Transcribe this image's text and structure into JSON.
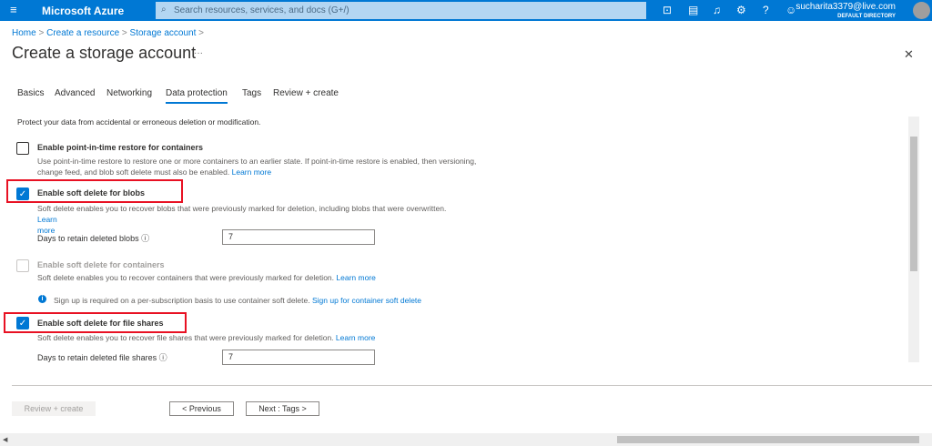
{
  "topbar": {
    "brand": "Microsoft Azure",
    "search_placeholder": "Search resources, services, and docs (G+/)",
    "user_email": "sucharita3379@live.com",
    "user_directory": "DEFAULT DIRECTORY"
  },
  "breadcrumb": [
    "Home",
    "Create a resource",
    "Storage account"
  ],
  "page": {
    "title": "Create a storage account",
    "more": "···",
    "close": "✕"
  },
  "tabs": [
    "Basics",
    "Advanced",
    "Networking",
    "Data protection",
    "Tags",
    "Review + create"
  ],
  "intro": "Protect your data from accidental or erroneous deletion or modification.",
  "options": {
    "pitr": {
      "label": "Enable point-in-time restore for containers",
      "checked": false,
      "desc1": "Use point-in-time restore to restore one or more containers to an earlier state. If point-in-time restore is enabled, then versioning,",
      "desc2": "change feed, and blob soft delete must also be enabled.",
      "link": "Learn more"
    },
    "blobs": {
      "label": "Enable soft delete for blobs",
      "checked": true,
      "desc1": "Soft delete enables you to recover blobs that were previously marked for deletion, including blobs that were overwritten.",
      "link1": "Learn",
      "link2": "more",
      "days_label": "Days to retain deleted blobs",
      "days_value": "7"
    },
    "containers": {
      "label": "Enable soft delete for containers",
      "checked": false,
      "disabled": true,
      "desc": "Soft delete enables you to recover containers that were previously marked for deletion.",
      "link": "Learn more",
      "info": "Sign up is required on a per-subscription basis to use container soft delete.",
      "info_link": "Sign up for container soft delete"
    },
    "shares": {
      "label": "Enable soft delete for file shares",
      "checked": true,
      "desc": "Soft delete enables you to recover file shares that were previously marked for deletion.",
      "link": "Learn more",
      "days_label": "Days to retain deleted file shares",
      "days_value": "7"
    }
  },
  "footer": {
    "review": "Review + create",
    "previous": "< Previous",
    "next": "Next : Tags >"
  },
  "colors": {
    "accent": "#0078d4",
    "highlight": "#e81123"
  }
}
